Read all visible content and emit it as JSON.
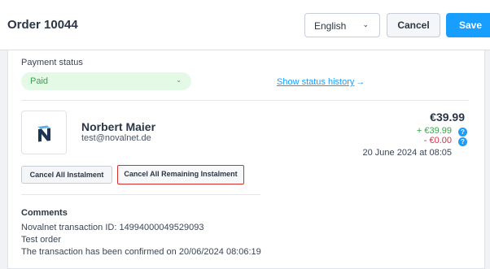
{
  "header": {
    "title": "Order 10044",
    "language": "English",
    "cancel_label": "Cancel",
    "save_label": "Save"
  },
  "payment": {
    "label": "Payment status",
    "status": "Paid",
    "history_link": "Show status history",
    "history_arrow": "→"
  },
  "customer": {
    "name": "Norbert Maier",
    "email": "test@novalnet.de",
    "logo": "novalnet-logo"
  },
  "amounts": {
    "total": "€39.99",
    "plus": "+ €39.99",
    "minus": "- €0.00",
    "date": "20 June 2024 at 08:05",
    "help_glyph": "?"
  },
  "actions": {
    "cancel_all": "Cancel All Instalment",
    "cancel_remaining": "Cancel All Remaining Instalment"
  },
  "comments": {
    "title": "Comments",
    "lines": [
      "Novalnet transaction ID: 14994000049529093",
      "Test order",
      "The transaction has been confirmed on 20/06/2024 08:06:19"
    ]
  },
  "colors": {
    "accent": "#189eff",
    "paid_green": "#37a54a",
    "negative_red": "#de294c",
    "highlight_border": "#d9302f"
  }
}
